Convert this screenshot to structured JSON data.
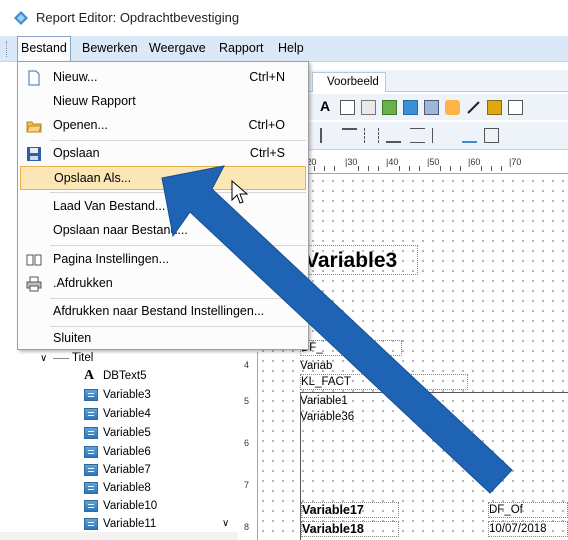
{
  "window": {
    "title": "Report Editor: Opdrachtbevestiging"
  },
  "menubar": {
    "items": [
      "Bestand",
      "Bewerken",
      "Weergave",
      "Rapport",
      "Help"
    ],
    "active": "Bestand"
  },
  "tab": {
    "label": "Voorbeeld"
  },
  "ruler": {
    "labels": [
      "|20",
      "|30",
      "|40",
      "|50",
      "|60",
      "|70"
    ]
  },
  "vruler": {
    "labels": [
      "4",
      "5",
      "6",
      "7",
      "8"
    ]
  },
  "bestand_menu": {
    "items": [
      {
        "label": "Nieuw...",
        "shortcut": "Ctrl+N",
        "icon": "new-document-icon"
      },
      {
        "label": "Nieuw Rapport",
        "shortcut": "",
        "icon": ""
      },
      {
        "label": "Openen...",
        "shortcut": "Ctrl+O",
        "icon": "open-folder-icon"
      },
      {
        "label": "Opslaan",
        "shortcut": "Ctrl+S",
        "icon": "floppy-disk-icon"
      },
      {
        "label": "Opslaan Als...",
        "shortcut": "",
        "icon": ""
      },
      {
        "label": "Laad Van Bestand...",
        "shortcut": "",
        "icon": ""
      },
      {
        "label": "Opslaan naar Bestand...",
        "shortcut": "",
        "icon": ""
      },
      {
        "label": "Pagina Instellingen...",
        "shortcut": "",
        "icon": "page-setup-icon"
      },
      {
        "label": ".Afdrukken",
        "shortcut": "C",
        "icon": "printer-icon"
      },
      {
        "label": "Afdrukken naar Bestand Instellingen...",
        "shortcut": "",
        "icon": ""
      },
      {
        "label": "Sluiten",
        "shortcut": "",
        "icon": ""
      }
    ],
    "highlighted": "Opslaan Als...",
    "highlight_color": "#fbe7b5"
  },
  "tree": {
    "group": "Titel",
    "items": [
      "DBText5",
      "Variable3",
      "Variable4",
      "Variable5",
      "Variable6",
      "Variable7",
      "Variable8",
      "Variable10",
      "Variable11"
    ]
  },
  "report": {
    "big_label": "Variable3",
    "fields": [
      "DF_",
      "Variab",
      "KL_FACT",
      "Variable1",
      "Variable36",
      "Variable17",
      "Variable18",
      "DF_Of",
      "10/07/2018"
    ]
  },
  "annotation": {
    "arrow_color": "#1f63b5"
  }
}
